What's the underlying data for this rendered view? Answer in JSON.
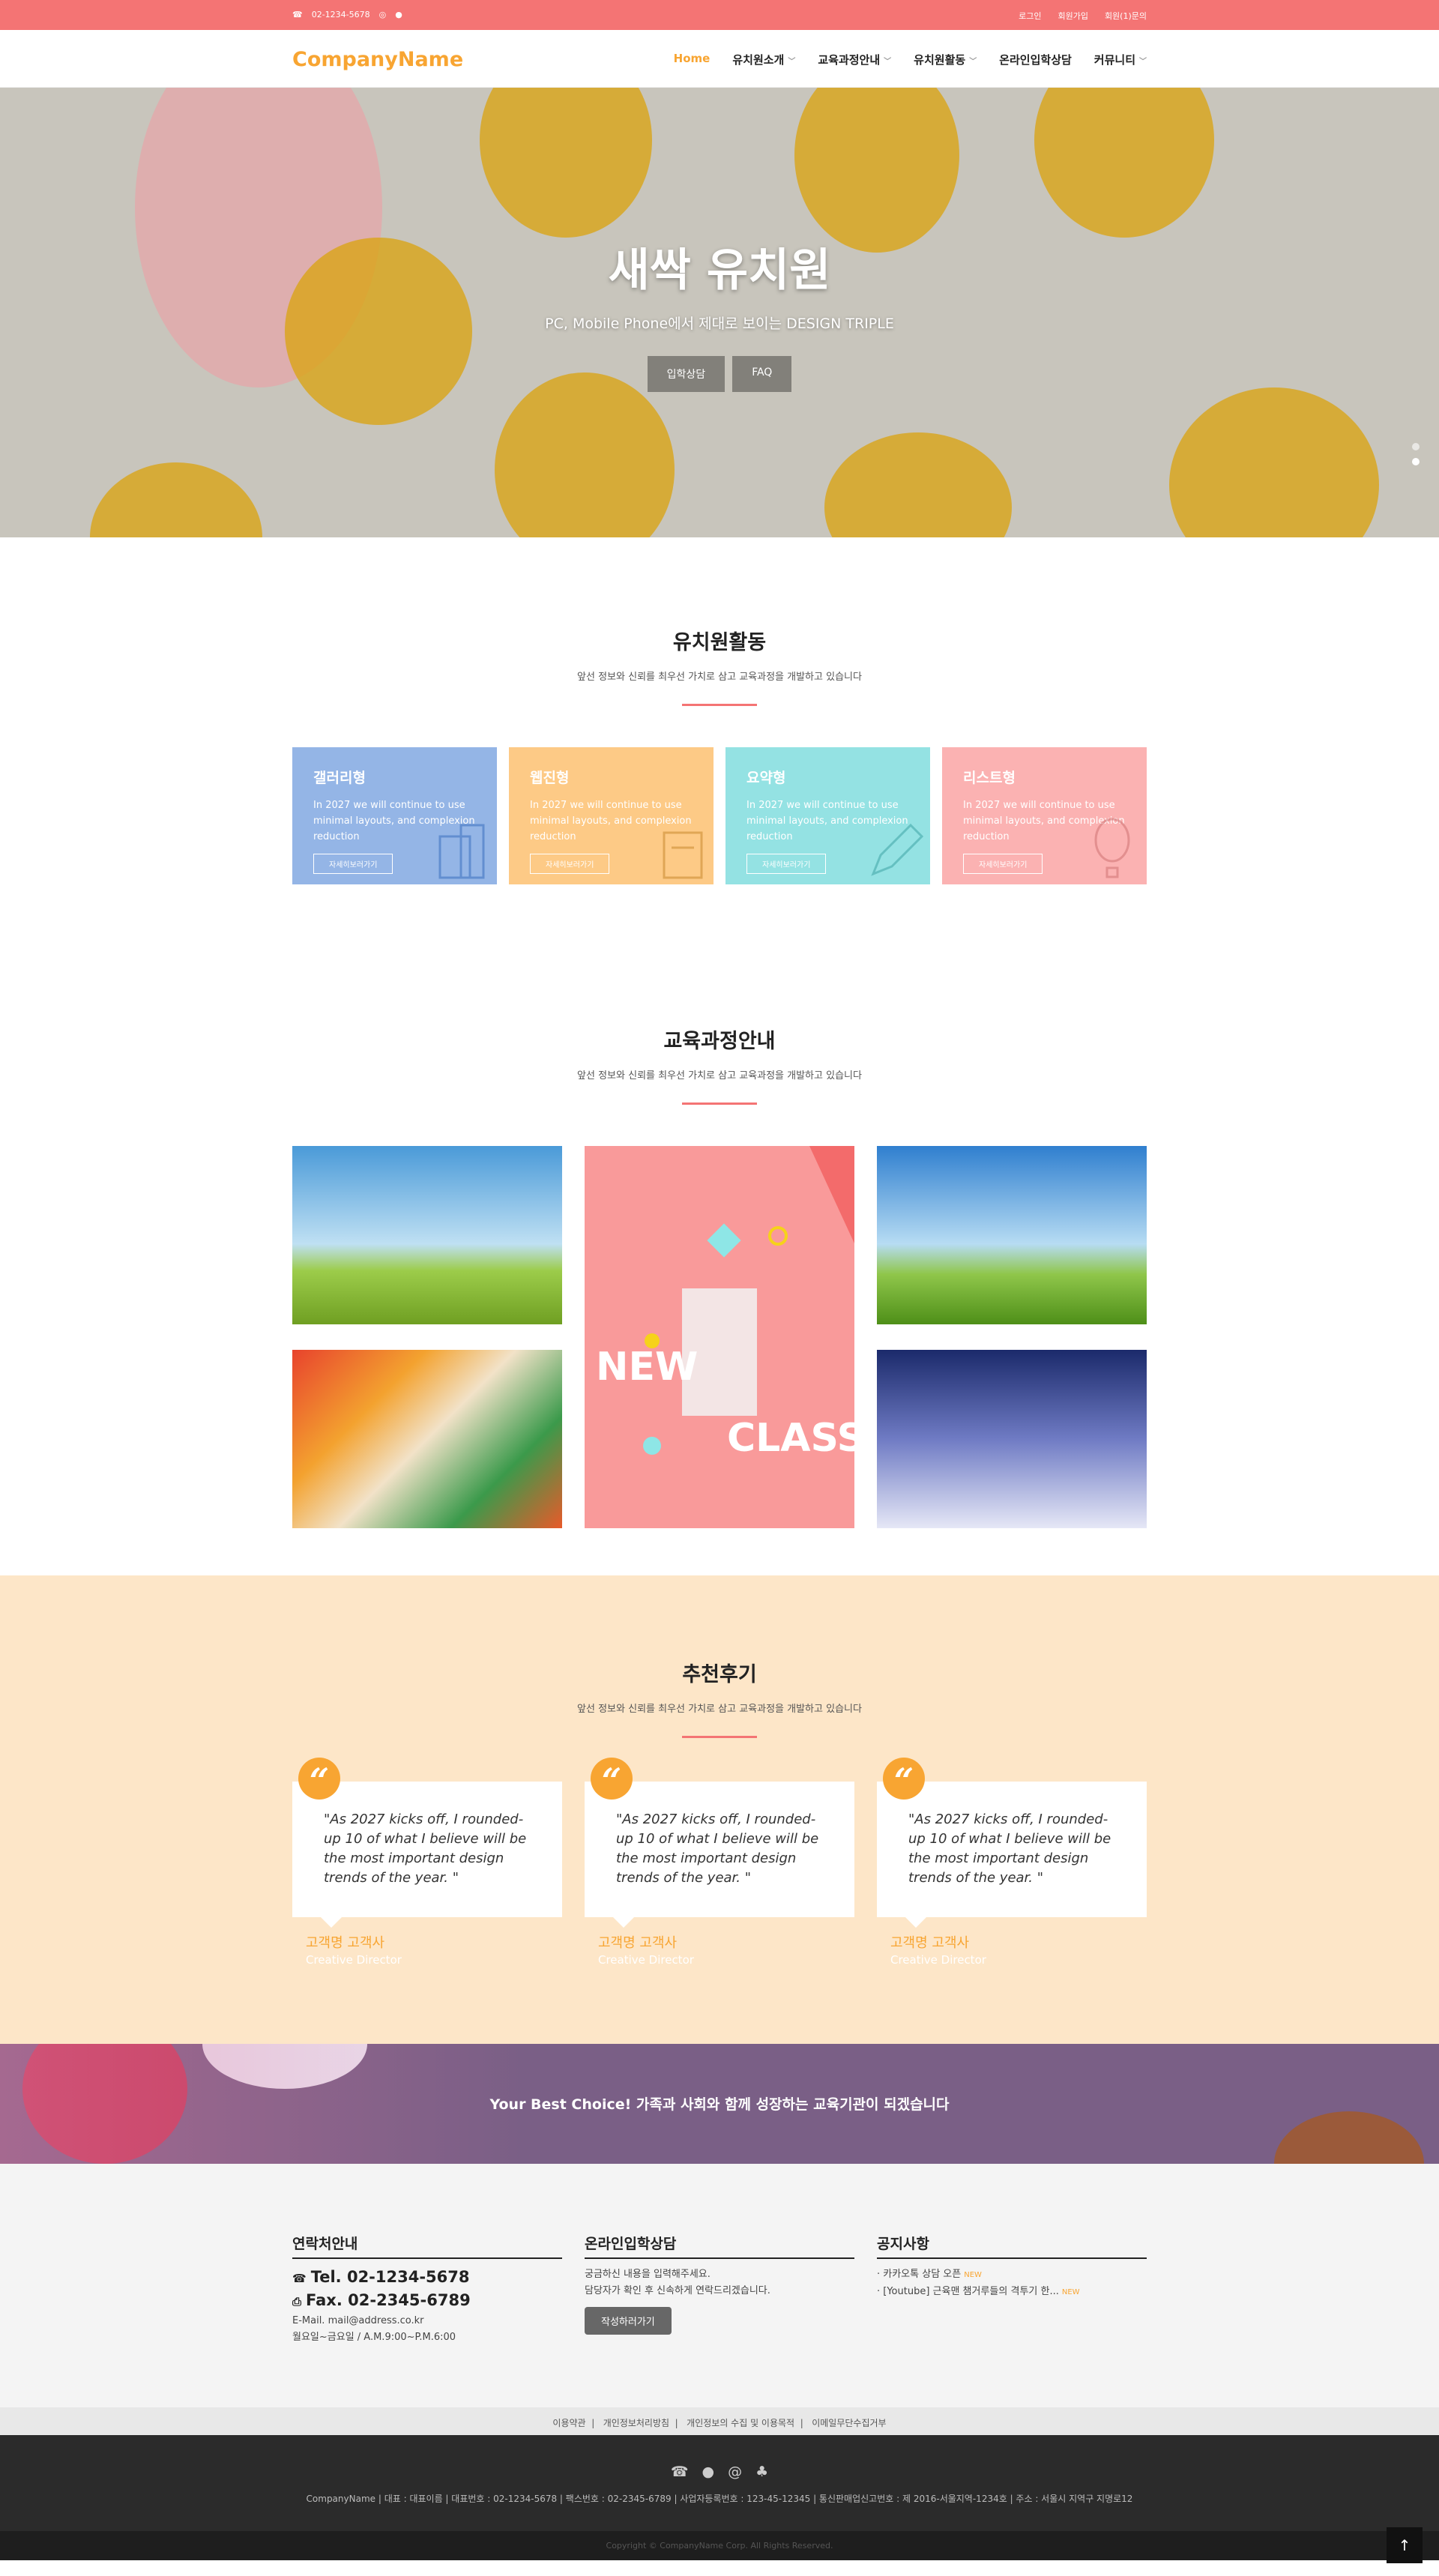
{
  "topbar": {
    "phone": "02-1234-5678",
    "links": [
      "로그인",
      "회원가입",
      "회원(1)문의"
    ]
  },
  "header": {
    "logo": "CompanyName",
    "nav": [
      "Home",
      "유치원소개",
      "교육과정안내",
      "유치원활동",
      "온라인입학상담",
      "커뮤니티"
    ]
  },
  "hero": {
    "title": "새싹 유치원",
    "subtitle": "PC, Mobile Phone에서 제대로 보이는 DESIGN TRIPLE",
    "buttons": [
      "입학상담",
      "FAQ"
    ]
  },
  "activities": {
    "title": "유치원활동",
    "desc": "앞선 정보와 신뢰를 최우선 가치로 삼고 교육과정을 개발하고 있습니다",
    "cards": [
      {
        "title": "갤러리형",
        "text": "In 2027 we will continue to use minimal layouts, and complexion reduction",
        "button": "자세히보러가기",
        "color": "#94b5e6"
      },
      {
        "title": "웹진형",
        "text": "In 2027 we will continue to use minimal layouts, and complexion reduction",
        "button": "자세히보러가기",
        "color": "#fdca86"
      },
      {
        "title": "요약형",
        "text": "In 2027 we will continue to use minimal layouts, and complexion reduction",
        "button": "자세히보러가기",
        "color": "#94e2e3"
      },
      {
        "title": "리스트형",
        "text": "In 2027 we will continue to use minimal layouts, and complexion reduction",
        "button": "자세히보러가기",
        "color": "#fbb2b2"
      }
    ]
  },
  "curriculum": {
    "title": "교육과정안내",
    "desc": "앞선 정보와 신뢰를 최우선 가치로 삼고 교육과정을 개발하고 있습니다",
    "new_label": "NEW",
    "class_label": "CLASS"
  },
  "reviews": {
    "title": "추천후기",
    "desc": "앞선 정보와 신뢰를 최우선 가치로 삼고 교육과정을 개발하고 있습니다",
    "items": [
      {
        "quote": "\"As 2027 kicks off, I rounded-up 10 of what I believe will be the most important design trends of the year. \"",
        "name": "고객명 고객사",
        "role": "Creative Director"
      },
      {
        "quote": "\"As 2027 kicks off, I rounded-up 10 of what I believe will be the most important design trends of the year. \"",
        "name": "고객명 고객사",
        "role": "Creative Director"
      },
      {
        "quote": "\"As 2027 kicks off, I rounded-up 10 of what I believe will be the most important design trends of the year. \"",
        "name": "고객명 고객사",
        "role": "Creative Director"
      }
    ]
  },
  "banner": {
    "text": "Your Best Choice! 가족과 사회와 함께 성장하는 교육기관이 되겠습니다"
  },
  "contact": {
    "title": "연락처안내",
    "tel": "Tel. 02-1234-5678",
    "fax": "Fax. 02-2345-6789",
    "email": "E-Mail. mail@address.co.kr",
    "hours": "월요일~금요일 / A.M.9:00~P.M.6:00"
  },
  "consult": {
    "title": "온라인입학상담",
    "line1": "궁금하신 내용을 입력해주세요.",
    "line2": "담당자가 확인 후 신속하게 연락드리겠습니다.",
    "button": "작성하러가기"
  },
  "notice": {
    "title": "공지사항",
    "items": [
      {
        "text": "· 카카오톡 상담 오픈",
        "badge": "NEW"
      },
      {
        "text": "· [Youtube] 근육맨 챔거루들의 격투기 한...",
        "badge": "NEW"
      }
    ]
  },
  "footer_links": [
    "이용약관",
    "개인정보처리방침",
    "개인정보의 수집 및 이용목적",
    "이메일무단수집거부"
  ],
  "footer": {
    "address": "CompanyName   |  대표 : 대표이름   |  대표번호 : 02-1234-5678   |  팩스번호 : 02-2345-6789   |  사업자등록번호 : 123-45-12345   |  통신판매업신고번호 : 제 2016-서울지역-1234호   |  주소 : 서울시 지역구 지명로12",
    "copyright": "Copyright © CompanyName Corp. All Rights Reserved."
  },
  "icons": [
    "phone-icon",
    "instagram-icon",
    "chat-icon",
    "kakao-icon",
    "blog-icon",
    "fax-icon",
    "arrow-up-icon"
  ],
  "colors": {
    "accent": "#f8a532",
    "topbar": "#f47474",
    "review_bg": "#fde6c8"
  }
}
